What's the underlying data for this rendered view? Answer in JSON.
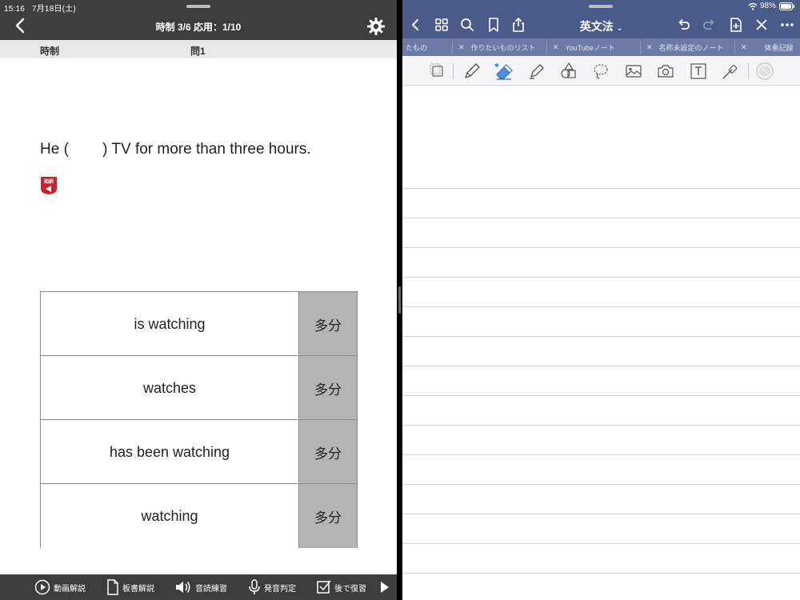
{
  "status_bar": {
    "time": "15:16",
    "date": "7月18日(土)",
    "battery": "98%"
  },
  "left_app": {
    "header_title": "時制 3/6 応用：1/10",
    "sub_category": "時制",
    "sub_question": "問1",
    "question_text": "He (        ) TV for more than three hours.",
    "choices": [
      {
        "text": "is watching",
        "mark": "多分"
      },
      {
        "text": "watches",
        "mark": "多分"
      },
      {
        "text": "has been watching",
        "mark": "多分"
      },
      {
        "text": "watching",
        "mark": "多分"
      }
    ],
    "footer": {
      "video_label": "動画解説",
      "board_label": "板書解説",
      "audio_label": "音読練習",
      "pronounce_label": "発音判定",
      "review_label": "後で復習"
    },
    "icons": [
      "back-chevron-icon",
      "gear-icon",
      "wayaku-audio-icon",
      "play-circle-icon",
      "document-icon",
      "speaker-icon",
      "microphone-icon",
      "checkbox-icon",
      "next-arrow-icon"
    ]
  },
  "right_app": {
    "title": "英文法",
    "tabs": [
      "たもの",
      "作りたいものリスト",
      "YouTubeノート",
      "名称未設定のノート",
      "体重記録"
    ],
    "icons": [
      "back-icon",
      "grid-icon",
      "search-icon",
      "bookmark-icon",
      "share-icon",
      "undo-icon",
      "redo-icon",
      "add-page-icon",
      "close-icon",
      "more-icon",
      "lasso-select-icon",
      "pen-icon",
      "eraser-icon",
      "highlighter-icon",
      "shapes-icon",
      "lasso-icon",
      "image-icon",
      "camera-icon",
      "text-box-icon",
      "laser-pointer-icon",
      "color-icon"
    ],
    "colors": {
      "header": "#4a5a8a",
      "tabbar": "#6d7aa5",
      "toolbar": "#f4f4f6"
    }
  }
}
